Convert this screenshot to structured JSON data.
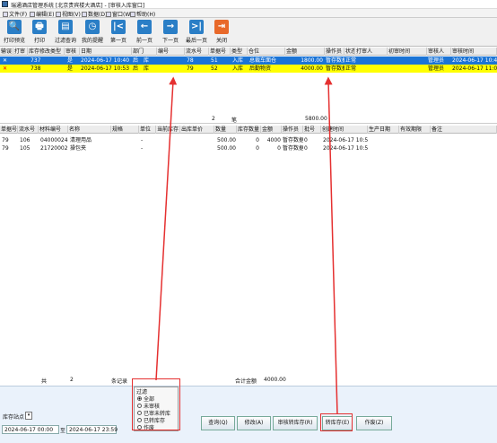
{
  "window": {
    "title": "瑞通酒店管理系统      [北京贵宾楼大酒店] - [审核入库窗口]"
  },
  "menu": [
    "文件(F)",
    "编辑(E)",
    "视图(V)",
    "数据(D)",
    "窗口(W)",
    "帮助(H)"
  ],
  "toolbar": [
    {
      "label": "打印预览",
      "icon": "preview-icon",
      "glyph": "🔍"
    },
    {
      "label": "打印",
      "icon": "printer-icon",
      "glyph": "🖶"
    },
    {
      "label": "过滤查询",
      "icon": "filter-icon",
      "glyph": "▤"
    },
    {
      "label": "我的提醒",
      "icon": "clock-icon",
      "glyph": "◷"
    },
    {
      "label": "第一页",
      "icon": "first-page-icon",
      "glyph": "|<"
    },
    {
      "label": "前一页",
      "icon": "prev-page-icon",
      "glyph": "←"
    },
    {
      "label": "下一页",
      "icon": "next-page-icon",
      "glyph": "→"
    },
    {
      "label": "最后一页",
      "icon": "last-page-icon",
      "glyph": ">|"
    },
    {
      "label": "关闭",
      "icon": "close-icon",
      "glyph": "⇥"
    }
  ],
  "grid1": {
    "headers": [
      "输误",
      "打审",
      "库存修改类型",
      "审核",
      "日期",
      "部门",
      "编号",
      "流水号",
      "单据号",
      "类型",
      "仓位",
      "金额",
      "操作员",
      "状态",
      "打审人",
      "初审时间",
      "审核人",
      "审核时间"
    ],
    "rows": [
      {
        "mark": "✕",
        "c1": "",
        "c2": "737",
        "c3": "是",
        "c4": "2024-06-17 10:40",
        "c5": "后",
        "c6": "库",
        "c7": "78",
        "c8": "51",
        "c9": "入库",
        "c10": "总裁车面仓",
        "c11": "1800.00",
        "c12": "暂存数据",
        "c13": "正常",
        "c14": "",
        "c15": "",
        "c16": "管理员",
        "c17": "2024-06-17 10:40"
      },
      {
        "mark": "✕",
        "c1": "",
        "c2": "738",
        "c3": "是",
        "c4": "2024-06-17 10:53",
        "c5": "后",
        "c6": "库",
        "c7": "79",
        "c8": "52",
        "c9": "入库",
        "c10": "后勤物资",
        "c11": "4000.00",
        "c12": "暂存数据",
        "c13": "正常",
        "c14": "",
        "c15": "",
        "c16": "管理员",
        "c17": "2024-06-17 11:00"
      }
    ],
    "count": "2",
    "count_unit": "笔",
    "total": "5800.00"
  },
  "grid2": {
    "headers": [
      "单据号",
      "流水号",
      "材料编号",
      "名称",
      "规格",
      "单位",
      "当前库存",
      "出库单价",
      "数量",
      "库存数量",
      "金额",
      "操作员",
      "批号",
      "创建时间",
      "生产日期",
      "有效期限",
      "备注"
    ],
    "rows": [
      [
        "79",
        "106",
        "04000024",
        "清理用品",
        "",
        "-",
        "",
        "",
        "500.00",
        "0",
        "4000",
        "暂存数据",
        "0",
        "2024-06-17 10:53",
        "",
        "",
        ""
      ],
      [
        "79",
        "105",
        "21720002",
        "操包夹",
        "",
        "-",
        "",
        "",
        "500.00",
        "0",
        "0",
        "暂存数据",
        "0",
        "2024-06-17 10:53",
        "",
        "",
        ""
      ]
    ],
    "footer": {
      "total_label": "共",
      "count": "2",
      "count_unit": "条记录",
      "amount_label": "合计金额",
      "amount": "4000.00"
    }
  },
  "bottom": {
    "stock_label": "库存站点",
    "date_from": "2024-06-17 00:00",
    "to_label": "至",
    "date_to": "2024-06-17 23:59",
    "filter_title": "过滤",
    "filter_options": [
      "全部",
      "未审核",
      "已审未转库",
      "已转库存",
      "作废"
    ],
    "buttons": [
      "查询(Q)",
      "修改(A)",
      "审核转库存(R)",
      "转库存(E)",
      "作废(Z)"
    ]
  },
  "colors": {
    "selected_row": "#1b74d6",
    "highlight_row": "#ffff00",
    "annotation": "#e53030",
    "accent": "#2a7ec6"
  }
}
